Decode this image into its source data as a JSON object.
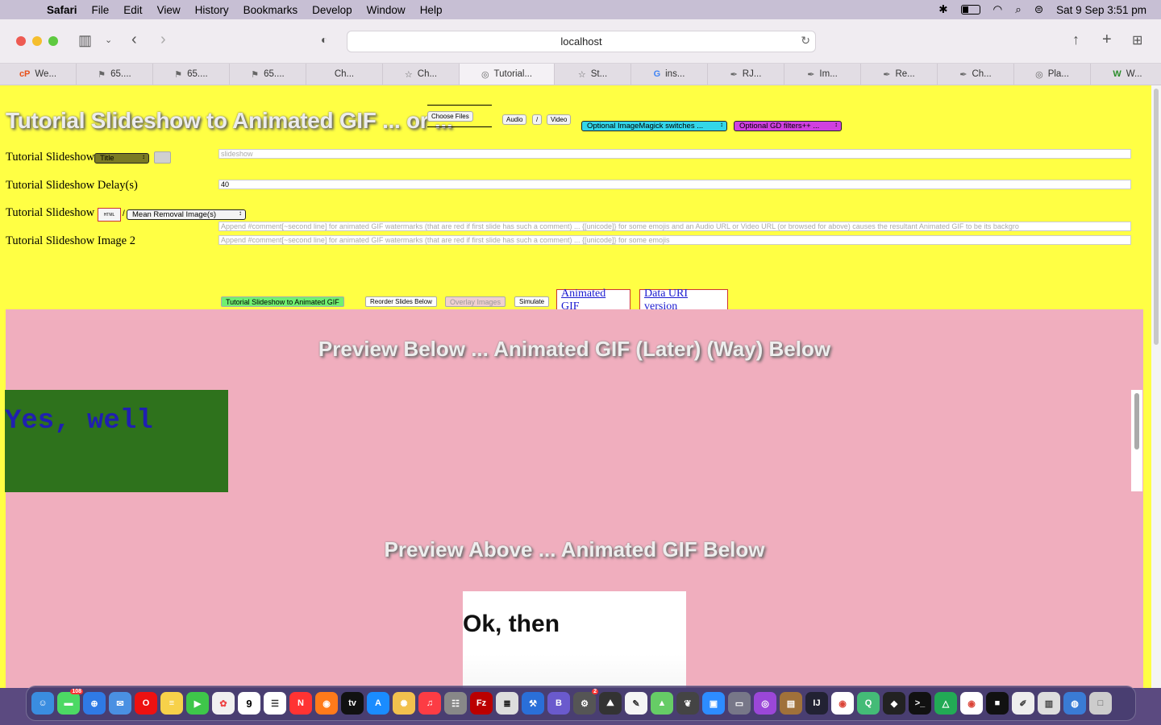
{
  "menubar": {
    "app": "Safari",
    "items": [
      "File",
      "Edit",
      "View",
      "History",
      "Bookmarks",
      "Develop",
      "Window",
      "Help"
    ],
    "datetime": "Sat 9 Sep  3:51 pm"
  },
  "browser": {
    "url": "localhost",
    "tabs": [
      "We...",
      "65....",
      "65....",
      "65....",
      "Ch...",
      "Ch...",
      "Tutorial...",
      "St...",
      "ins...",
      "RJ...",
      "Im...",
      "Re...",
      "Ch...",
      "Pla...",
      "W..."
    ],
    "active_tab_index": 6
  },
  "page": {
    "title": "Tutorial Slideshow to Animated GIF ... or ...",
    "choose_files": "Choose Files",
    "audio_button": "Audio",
    "slash": "/",
    "video_button": "Video",
    "imagemagick_select": "Optional ImageMagick switches ...",
    "gd_select": "Optional GD filters++ ...",
    "row1_label": "Tutorial Slideshow",
    "row1_select": "Title",
    "row1_placeholder": "slideshow",
    "row2_label": "Tutorial Slideshow Delay(s)",
    "row2_value": "40",
    "row3_label": "Tutorial Slideshow",
    "html_button": "HTML",
    "row3_select": "Mean Removal Image(s)",
    "row3_placeholder": "Append #comment[~second line] for animated GIF watermarks (that are red if first slide has such a comment) ... {[unicode]} for some emojis and an Audio URL or Video URL (or browsed for above) causes the resultant Animated GIF to be its backgro",
    "row4_label": "Tutorial Slideshow Image 2",
    "row4_placeholder": "Append #comment[~second line] for animated GIF watermarks (that are red if first slide has such a comment) ... {[unicode]} for some emojis",
    "btn_convert": "Tutorial Slideshow to Animated GIF",
    "btn_reorder": "Reorder Slides Below",
    "btn_overlay": "Overlay Images",
    "btn_simulate": "Simulate",
    "link_gif": "Animated GIF",
    "link_datauri": "Data URI version",
    "preview_title_1": "Preview Below ... Animated GIF (Later) (Way) Below",
    "slide_text": "Yes, well",
    "preview_title_2": "Preview Above ... Animated GIF Below",
    "gif_text": "Ok, then"
  },
  "dock": {
    "badges": {
      "messages": "108",
      "calendar_day": "9",
      "settings": "2"
    }
  },
  "colors": {
    "page_bg": "#ffff44",
    "preview_bg": "#f0aebe",
    "imagemagick_select_bg": "#33d6e8",
    "gd_select_bg": "#d040e0",
    "convert_btn_bg": "#70f070",
    "slide_bg": "#2e721c"
  }
}
